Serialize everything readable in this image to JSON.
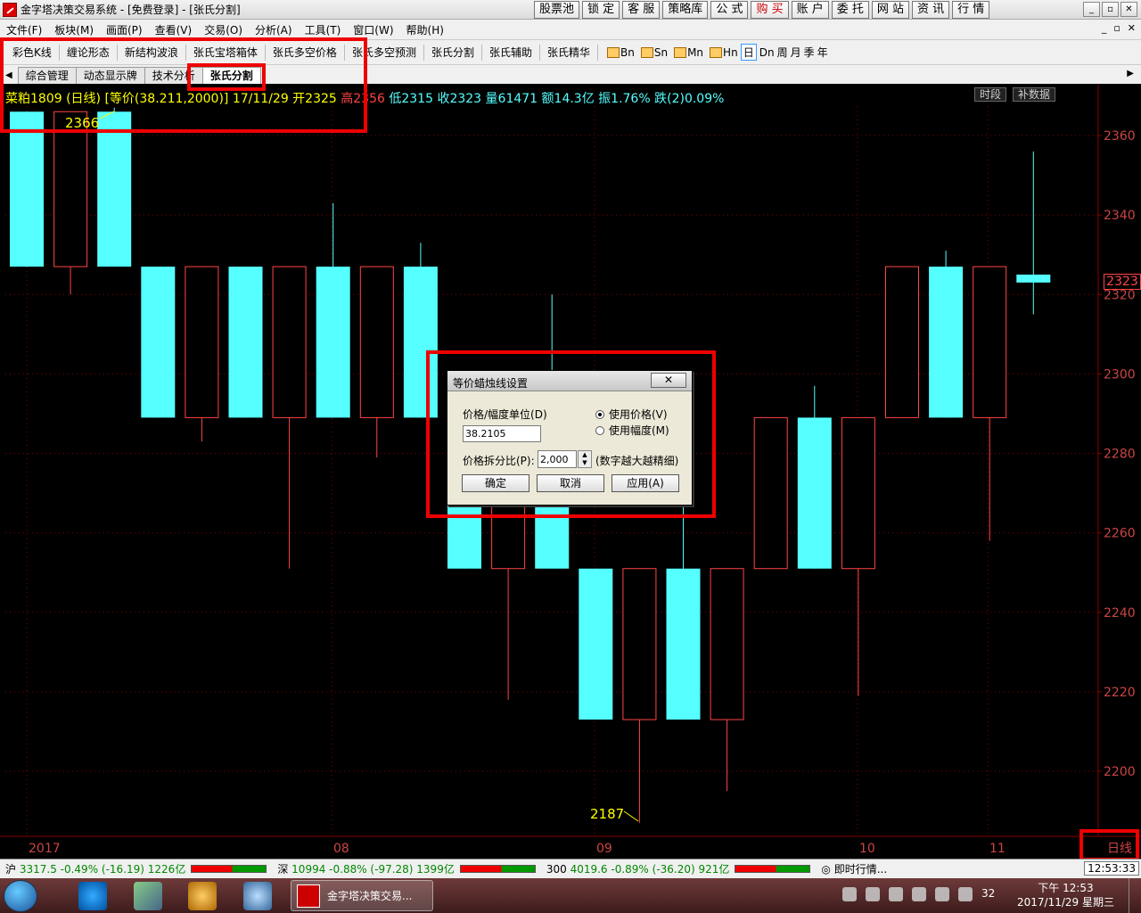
{
  "window": {
    "title": "金字塔决策交易系统 - [免费登录] - [张氏分割]",
    "toolbar_buttons": [
      "股票池",
      "锁 定",
      "客 服",
      "策略库",
      "公 式",
      "购 买",
      "账 户",
      "委 托",
      "网 站",
      "资 讯",
      "行 情"
    ],
    "win_controls": [
      "_",
      "▫",
      "✕"
    ]
  },
  "menu": {
    "items": [
      "文件(F)",
      "板块(M)",
      "画面(P)",
      "查看(V)",
      "交易(O)",
      "分析(A)",
      "工具(T)",
      "窗口(W)",
      "帮助(H)"
    ],
    "mdi_controls": [
      "_",
      "▫",
      "✕"
    ]
  },
  "indicator_bar": {
    "items": [
      "彩色K线",
      "缠论形态",
      "新结构波浪",
      "张氏宝塔箱体",
      "张氏多空价格",
      "张氏多空预测",
      "张氏分割",
      "张氏辅助",
      "张氏精华"
    ],
    "periods": [
      "Bn",
      "Sn",
      "Mn",
      "Hn",
      "日",
      "Dn",
      "周",
      "月",
      "季",
      "年"
    ],
    "selected_period": "日"
  },
  "tabs": {
    "items": [
      "综合管理",
      "动态显示牌",
      "技术分析",
      "张氏分割"
    ],
    "active": "张氏分割"
  },
  "chart_info": {
    "symbol": "菜粕1809 (日线)",
    "indicator": "[等价(38.211,2000)]",
    "date_open": "17/11/29 开2325",
    "high": "高2356",
    "low": "低2315",
    "close": "收2323",
    "volume": "量61471",
    "amount": "额14.3亿",
    "amplitude": "振1.76%",
    "change": "跌(2)0.09%",
    "chip_time": "时段",
    "chip_data": "补数据",
    "high_marker": "2366",
    "low_marker": "2187",
    "current_price": "2323",
    "period_label": "日线",
    "y_ticks": [
      "2360",
      "2340",
      "2320",
      "2300",
      "2280",
      "2260",
      "2240",
      "2220",
      "2200"
    ],
    "x_ticks": [
      "2017",
      "08",
      "09",
      "10",
      "11"
    ]
  },
  "chart_data": {
    "type": "candlestick",
    "title": "菜粕1809 (日线)",
    "ylim": [
      2185,
      2370
    ],
    "y_ticks": [
      2360,
      2340,
      2320,
      2300,
      2280,
      2260,
      2240,
      2220,
      2200
    ],
    "x_ticks": [
      "2017",
      "08",
      "09",
      "10",
      "11"
    ],
    "grid": true,
    "brick_step": 38.2105,
    "bars": [
      {
        "open": 2327,
        "close": 2366,
        "high": 2366,
        "low": 2327,
        "dir": "down"
      },
      {
        "open": 2327,
        "close": 2366,
        "high": 2366,
        "low": 2320,
        "dir": "up"
      },
      {
        "open": 2327,
        "close": 2366,
        "high": 2367,
        "low": 2327,
        "dir": "down"
      },
      {
        "open": 2327,
        "close": 2289,
        "high": 2327,
        "low": 2289,
        "dir": "down"
      },
      {
        "open": 2289,
        "close": 2327,
        "high": 2327,
        "low": 2283,
        "dir": "up"
      },
      {
        "open": 2327,
        "close": 2289,
        "high": 2327,
        "low": 2289,
        "dir": "down"
      },
      {
        "open": 2289,
        "close": 2327,
        "high": 2327,
        "low": 2251,
        "dir": "up"
      },
      {
        "open": 2327,
        "close": 2289,
        "high": 2343,
        "low": 2289,
        "dir": "down"
      },
      {
        "open": 2289,
        "close": 2327,
        "high": 2327,
        "low": 2279,
        "dir": "up"
      },
      {
        "open": 2327,
        "close": 2289,
        "high": 2333,
        "low": 2289,
        "dir": "down"
      },
      {
        "open": 2289,
        "close": 2251,
        "high": 2289,
        "low": 2251,
        "dir": "down"
      },
      {
        "open": 2251,
        "close": 2289,
        "high": 2289,
        "low": 2218,
        "dir": "up"
      },
      {
        "open": 2289,
        "close": 2251,
        "high": 2320,
        "low": 2251,
        "dir": "down"
      },
      {
        "open": 2251,
        "close": 2213,
        "high": 2251,
        "low": 2213,
        "dir": "down"
      },
      {
        "open": 2213,
        "close": 2251,
        "high": 2251,
        "low": 2187,
        "dir": "up"
      },
      {
        "open": 2251,
        "close": 2213,
        "high": 2267,
        "low": 2213,
        "dir": "down"
      },
      {
        "open": 2213,
        "close": 2251,
        "high": 2251,
        "low": 2195,
        "dir": "up"
      },
      {
        "open": 2251,
        "close": 2289,
        "high": 2289,
        "low": 2251,
        "dir": "up"
      },
      {
        "open": 2289,
        "close": 2251,
        "high": 2297,
        "low": 2251,
        "dir": "down"
      },
      {
        "open": 2251,
        "close": 2289,
        "high": 2289,
        "low": 2219,
        "dir": "up"
      },
      {
        "open": 2289,
        "close": 2327,
        "high": 2327,
        "low": 2289,
        "dir": "up"
      },
      {
        "open": 2289,
        "close": 2327,
        "high": 2331,
        "low": 2289,
        "dir": "down"
      },
      {
        "open": 2327,
        "close": 2289,
        "high": 2327,
        "low": 2258,
        "dir": "up"
      },
      {
        "open": 2325,
        "close": 2323,
        "high": 2356,
        "low": 2315,
        "dir": "down"
      }
    ]
  },
  "dialog": {
    "title": "等价蜡烛线设置",
    "close": "✕",
    "unit_label": "价格/幅度单位(D)",
    "unit_value": "38.2105",
    "radio_price": "使用价格(V)",
    "radio_amplitude": "使用幅度(M)",
    "ratio_label": "价格拆分比(P):",
    "ratio_value": "2,000",
    "ratio_hint": "(数字越大越精细)",
    "ok": "确定",
    "cancel": "取消",
    "apply": "应用(A)"
  },
  "statusbar": {
    "sh": "沪",
    "sh_vals": "3317.5 -0.49% (-16.19) 1226亿",
    "sz": "深",
    "sz_vals": "10994 -0.88% (-97.28) 1399亿",
    "hs300": "300",
    "hs300_vals": "4019.6 -0.89% (-36.20) 921亿",
    "realtime": "即时行情...",
    "clock": "12:53:33"
  },
  "taskbar": {
    "task_label": "金字塔决策交易...",
    "badge": "32",
    "time": "下午 12:53",
    "date": "2017/11/29 星期三"
  },
  "colors": {
    "up_color": "#55ffff",
    "down_border": "#ff4444",
    "grid": "#880000",
    "highlight": "#ee0000"
  }
}
